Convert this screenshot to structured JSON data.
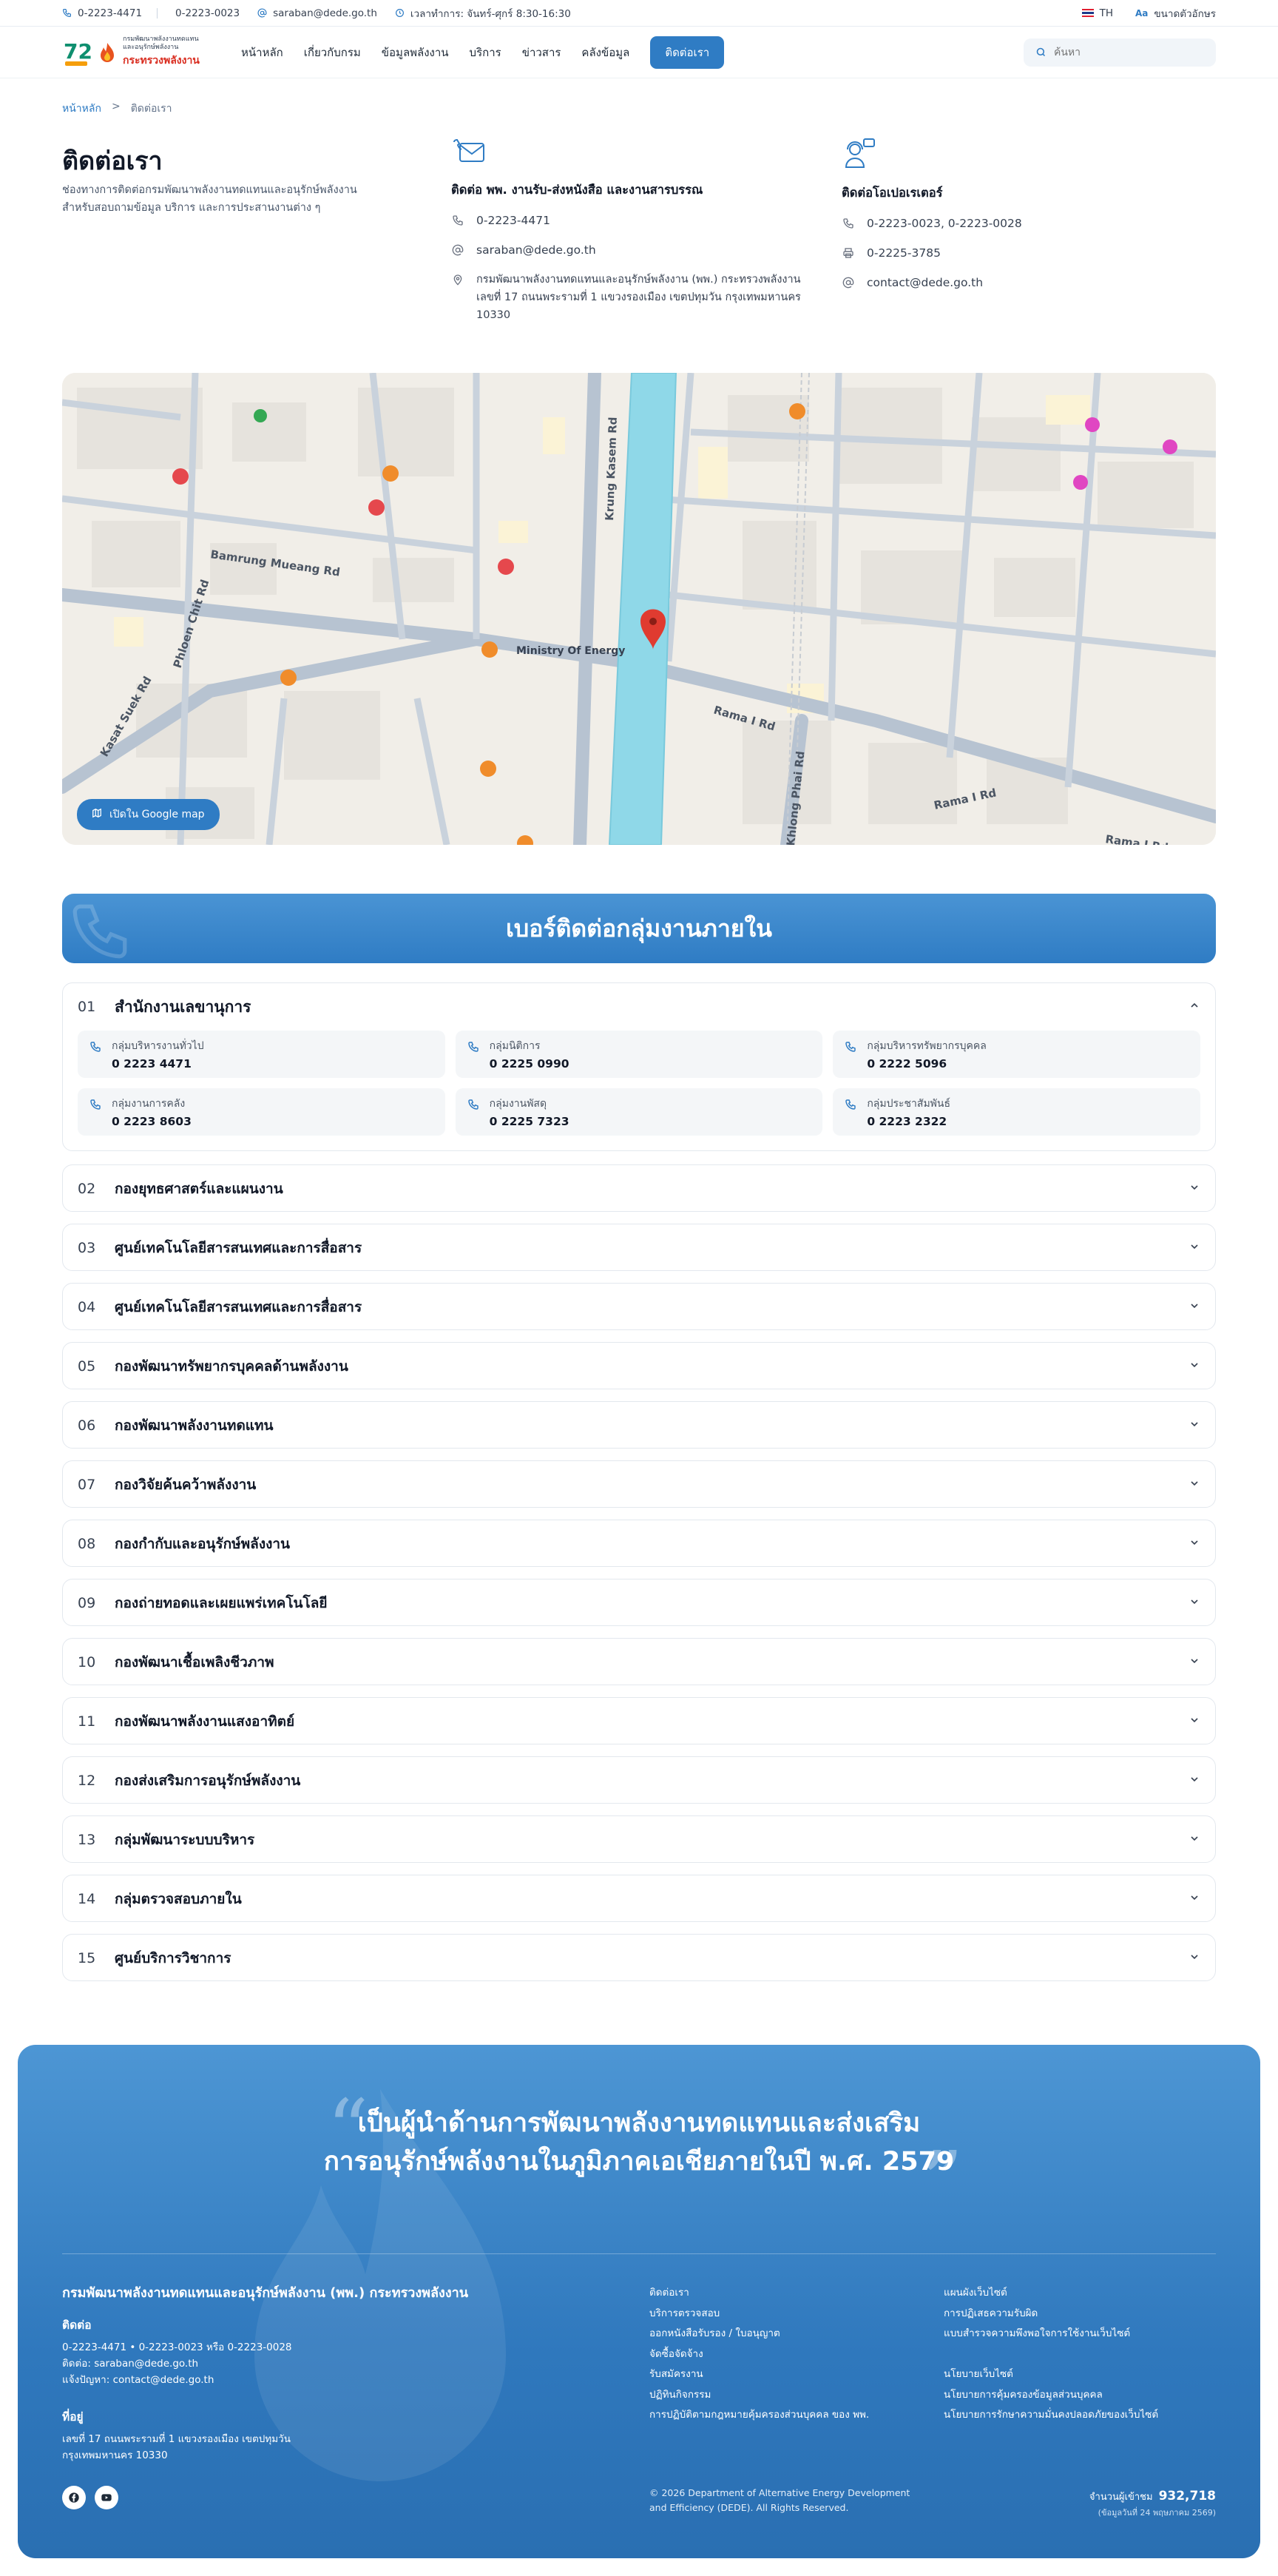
{
  "topbar": {
    "phone1": "0-2223-4471",
    "phone2": "0-2223-0023",
    "email": "saraban@dede.go.th",
    "hours": "เวลาทำการ: จันทร์-ศุกร์ 8:30-16:30",
    "lang": "TH",
    "font_size": "ขนาดตัวอักษร"
  },
  "logo": {
    "line1": "กรมพัฒนาพลังงานทดแทน",
    "line2": "และอนุรักษ์พลังงาน",
    "line3": "กระทรวงพลังงาน"
  },
  "nav": {
    "items": [
      "หน้าหลัก",
      "เกี่ยวกับกรม",
      "ข้อมูลพลังงาน",
      "บริการ",
      "ข่าวสาร",
      "คลังข้อมูล"
    ],
    "cta": "ติดต่อเรา",
    "search_placeholder": "ค้นหา"
  },
  "breadcrumb": {
    "home": "หน้าหลัก",
    "sep": ">",
    "current": "ติดต่อเรา"
  },
  "contact": {
    "title": "ติดต่อเรา",
    "desc": "ช่องทางการติดต่อกรมพัฒนาพลังงานทดแทนและอนุรักษ์พลังงาน สำหรับสอบถามข้อมูล บริการ และการประสานงานต่าง ๆ",
    "saraban": {
      "heading": "ติดต่อ พพ. งานรับ-ส่งหนังสือ และงานสารบรรณ",
      "phone": "0-2223-4471",
      "email": "saraban@dede.go.th",
      "address": "กรมพัฒนาพลังงานทดแทนและอนุรักษ์พลังงาน (พพ.) กระทรวงพลังงาน เลขที่ 17 ถนนพระรามที่ 1 แขวงรองเมือง เขตปทุมวัน กรุงเทพมหานคร 10330"
    },
    "operator": {
      "heading": "ติดต่อโอเปอเรเตอร์",
      "phone": "0-2223-0023, 0-2223-0028",
      "fax": "0-2225-3785",
      "email": "contact@dede.go.th"
    }
  },
  "map": {
    "button": "เปิดใน Google map",
    "labels": {
      "road1": "Bamrung Mueang Rd",
      "road2": "Phloen Chit Rd",
      "road3": "Kasat Suek Rd",
      "road4": "Krung Kasem Rd",
      "road5": "Rama I Rd",
      "road6": "Rama I Rd",
      "road7": "Rama I Rd",
      "road8": "Khlong Phai Rd",
      "place": "Ministry Of Energy"
    }
  },
  "section": {
    "title": "เบอร์ติดต่อกลุ่มงานภายใน"
  },
  "departments": [
    {
      "num": "01",
      "name": "สำนักงานเลขานุการ",
      "open": true,
      "contacts": [
        {
          "label": "กลุ่มบริหารงานทั่วไป",
          "phone": "0 2223 4471"
        },
        {
          "label": "กลุ่มนิติการ",
          "phone": "0 2225 0990"
        },
        {
          "label": "กลุ่มบริหารทรัพยากรบุคคล",
          "phone": "0 2222 5096"
        },
        {
          "label": "กลุ่มงานการคลัง",
          "phone": "0 2223 8603"
        },
        {
          "label": "กลุ่มงานพัสดุ",
          "phone": "0 2225 7323"
        },
        {
          "label": "กลุ่มประชาสัมพันธ์",
          "phone": "0 2223 2322"
        }
      ]
    },
    {
      "num": "02",
      "name": "กองยุทธศาสตร์และแผนงาน"
    },
    {
      "num": "03",
      "name": "ศูนย์เทคโนโลยีสารสนเทศและการสื่อสาร"
    },
    {
      "num": "04",
      "name": "ศูนย์เทคโนโลยีสารสนเทศและการสื่อสาร"
    },
    {
      "num": "05",
      "name": "กองพัฒนาทรัพยากรบุคคลด้านพลังงาน"
    },
    {
      "num": "06",
      "name": "กองพัฒนาพลังงานทดแทน"
    },
    {
      "num": "07",
      "name": "กองวิจัยค้นคว้าพลังงาน"
    },
    {
      "num": "08",
      "name": "กองกำกับและอนุรักษ์พลังงาน"
    },
    {
      "num": "09",
      "name": "กองถ่ายทอดและเผยแพร่เทคโนโลยี"
    },
    {
      "num": "10",
      "name": "กองพัฒนาเชื้อเพลิงชีวภาพ"
    },
    {
      "num": "11",
      "name": "กองพัฒนาพลังงานแสงอาทิตย์"
    },
    {
      "num": "12",
      "name": "กองส่งเสริมการอนุรักษ์พลังงาน"
    },
    {
      "num": "13",
      "name": "กลุ่มพัฒนาระบบบริหาร"
    },
    {
      "num": "14",
      "name": "กลุ่มตรวจสอบภายใน"
    },
    {
      "num": "15",
      "name": "ศูนย์บริการวิชาการ"
    }
  ],
  "footer": {
    "quote_line1": "เป็นผู้นำด้านการพัฒนาพลังงานทดแทนและส่งเสริม",
    "quote_line2": "การอนุรักษ์พลังงานในภูมิภาคเอเชียภายในปี พ.ศ. 2579",
    "org": "กรมพัฒนาพลังงานทดแทนและอนุรักษ์พลังงาน (พพ.) กระทรวงพลังงาน",
    "contact_heading": "ติดต่อ",
    "contact_lines": [
      "0-2223-4471 • 0-2223-0023 หรือ 0-2223-0028",
      "ติดต่อ: saraban@dede.go.th",
      "แจ้งปัญหา: contact@dede.go.th"
    ],
    "address_heading": "ที่อยู่",
    "address_lines": [
      "เลขที่ 17 ถนนพระรามที่ 1 แขวงรองเมือง เขตปทุมวัน",
      "กรุงเทพมหานคร 10330"
    ],
    "links_col1": [
      "ติดต่อเรา",
      "บริการตรวจสอบ",
      "ออกหนังสือรับรอง / ใบอนุญาต",
      "จัดซื้อจัดจ้าง",
      "รับสมัครงาน",
      "ปฏิทินกิจกรรม",
      "การปฏิบัติตามกฎหมายคุ้มครองส่วนบุคคล ของ พพ."
    ],
    "links_col2": [
      "แผนผังเว็บไซต์",
      "การปฏิเสธความรับผิด",
      "แบบสำรวจความพึงพอใจการใช้งานเว็บไซต์"
    ],
    "links_col3": [
      "นโยบายเว็บไซต์",
      "นโยบายการคุ้มครองข้อมูลส่วนบุคคล",
      "นโยบายการรักษาความมั่นคงปลอดภัยของเว็บไซต์"
    ],
    "copyright": "© 2026 Department of Alternative Energy Development and Efficiency (DEDE). All Rights Reserved.",
    "visitors_label": "จำนวนผู้เข้าชม",
    "visitors": "932,718",
    "visitors_note": "(ข้อมูลวันที่ 24 พฤษภาคม 2569)"
  },
  "colors": {
    "accent": "#2f7cc4",
    "footer": "#3b86c9",
    "text": "#1f2a37"
  }
}
